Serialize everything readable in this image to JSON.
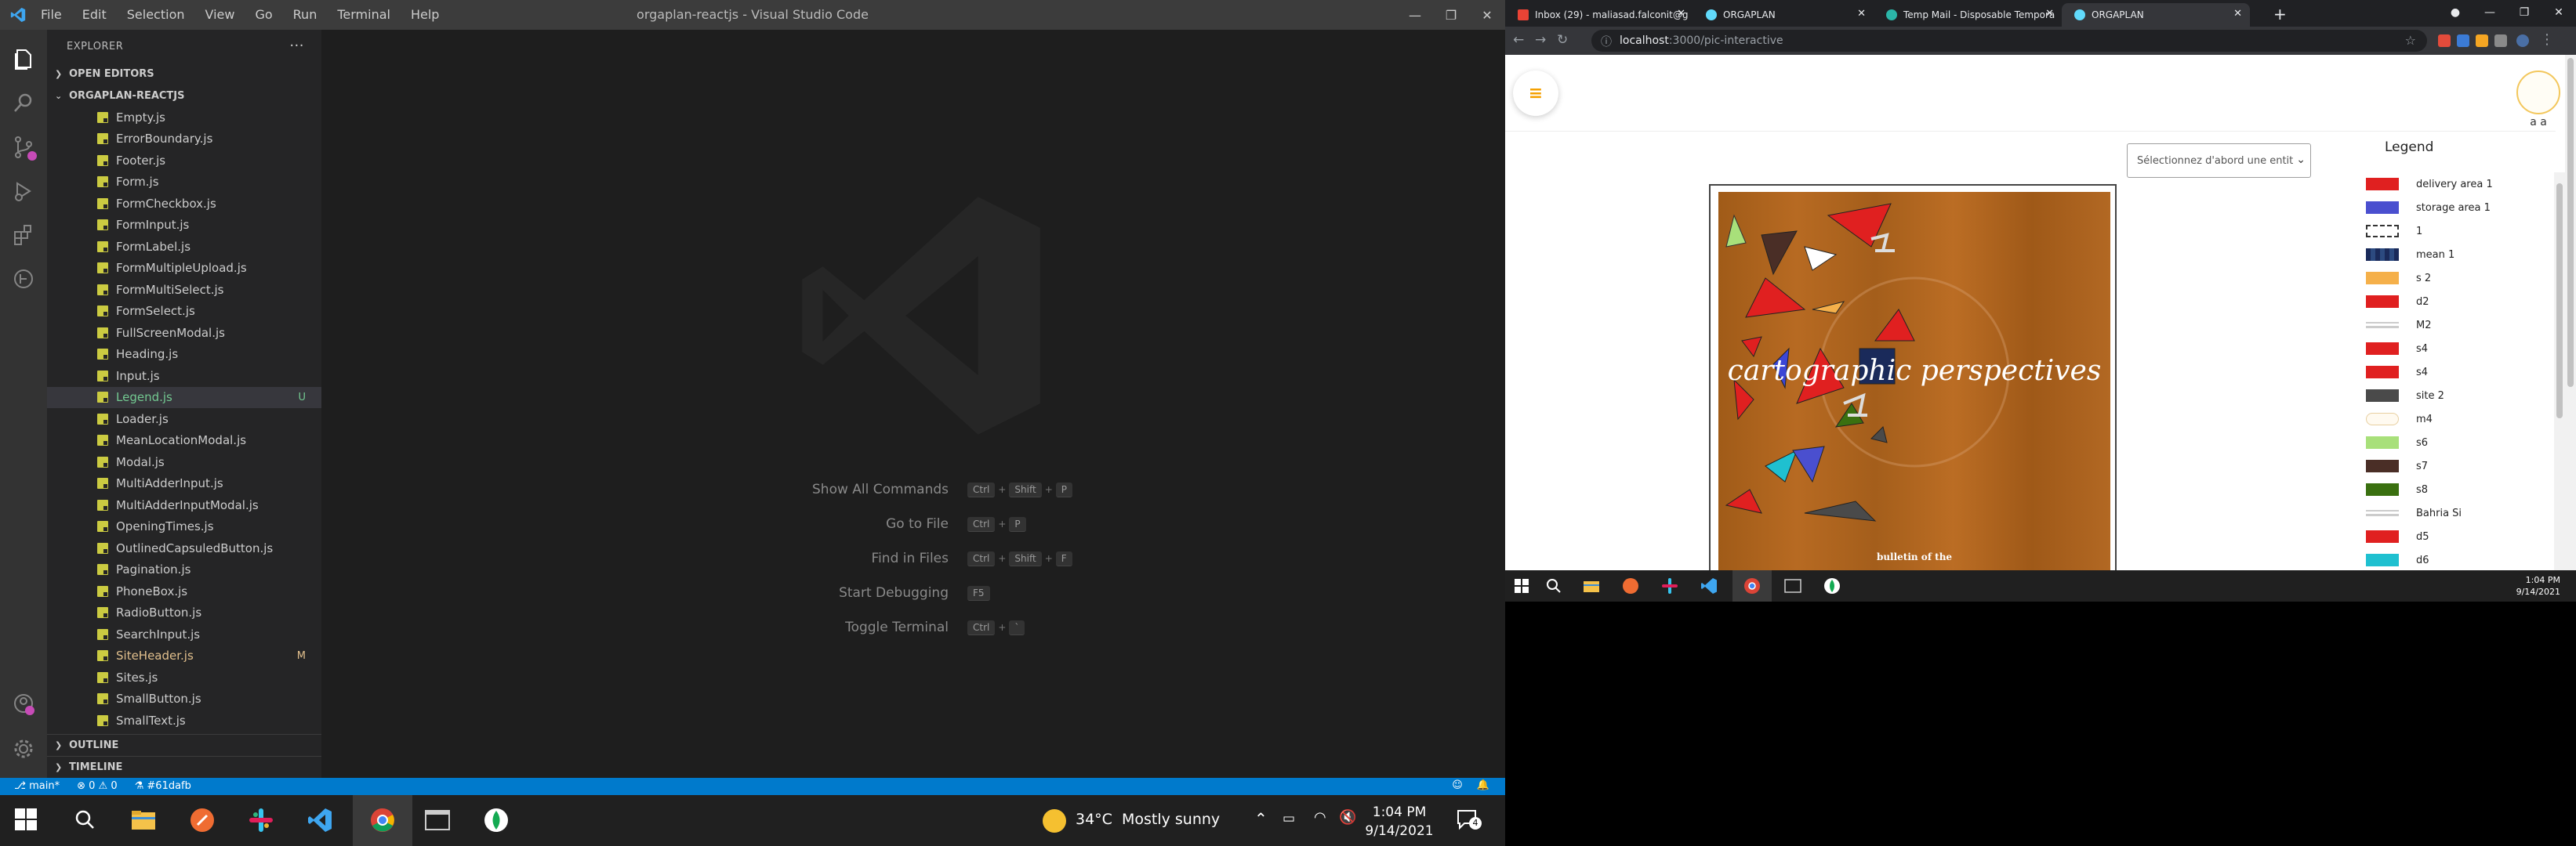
{
  "vscode": {
    "window_title": "orgaplan-reactjs - Visual Studio Code",
    "menu": [
      "File",
      "Edit",
      "Selection",
      "View",
      "Go",
      "Run",
      "Terminal",
      "Help"
    ],
    "explorer_label": "EXPLORER",
    "more_actions": "···",
    "open_editors": "OPEN EDITORS",
    "project": "ORGAPLAN-REACTJS",
    "files": [
      {
        "name": "Empty.js",
        "badge": "",
        "state": ""
      },
      {
        "name": "ErrorBoundary.js",
        "badge": "",
        "state": ""
      },
      {
        "name": "Footer.js",
        "badge": "",
        "state": ""
      },
      {
        "name": "Form.js",
        "badge": "",
        "state": ""
      },
      {
        "name": "FormCheckbox.js",
        "badge": "",
        "state": ""
      },
      {
        "name": "FormInput.js",
        "badge": "",
        "state": ""
      },
      {
        "name": "FormLabel.js",
        "badge": "",
        "state": ""
      },
      {
        "name": "FormMultipleUpload.js",
        "badge": "",
        "state": ""
      },
      {
        "name": "FormMultiSelect.js",
        "badge": "",
        "state": ""
      },
      {
        "name": "FormSelect.js",
        "badge": "",
        "state": ""
      },
      {
        "name": "FullScreenModal.js",
        "badge": "",
        "state": ""
      },
      {
        "name": "Heading.js",
        "badge": "",
        "state": ""
      },
      {
        "name": "Input.js",
        "badge": "",
        "state": ""
      },
      {
        "name": "Legend.js",
        "badge": "U",
        "state": "untracked"
      },
      {
        "name": "Loader.js",
        "badge": "",
        "state": ""
      },
      {
        "name": "MeanLocationModal.js",
        "badge": "",
        "state": ""
      },
      {
        "name": "Modal.js",
        "badge": "",
        "state": ""
      },
      {
        "name": "MultiAdderInput.js",
        "badge": "",
        "state": ""
      },
      {
        "name": "MultiAdderInputModal.js",
        "badge": "",
        "state": ""
      },
      {
        "name": "OpeningTimes.js",
        "badge": "",
        "state": ""
      },
      {
        "name": "OutlinedCapsuledButton.js",
        "badge": "",
        "state": ""
      },
      {
        "name": "Pagination.js",
        "badge": "",
        "state": ""
      },
      {
        "name": "PhoneBox.js",
        "badge": "",
        "state": ""
      },
      {
        "name": "RadioButton.js",
        "badge": "",
        "state": ""
      },
      {
        "name": "SearchInput.js",
        "badge": "",
        "state": ""
      },
      {
        "name": "SiteHeader.js",
        "badge": "M",
        "state": "modified"
      },
      {
        "name": "Sites.js",
        "badge": "",
        "state": ""
      },
      {
        "name": "SmallButton.js",
        "badge": "",
        "state": ""
      },
      {
        "name": "SmallText.js",
        "badge": "",
        "state": ""
      }
    ],
    "outline": "OUTLINE",
    "timeline": "TIMELINE",
    "shortcuts": [
      {
        "label": "Show All Commands",
        "keys": [
          "Ctrl",
          "Shift",
          "P"
        ]
      },
      {
        "label": "Go to File",
        "keys": [
          "Ctrl",
          "P"
        ]
      },
      {
        "label": "Find in Files",
        "keys": [
          "Ctrl",
          "Shift",
          "F"
        ]
      },
      {
        "label": "Start Debugging",
        "keys": [
          "F5"
        ]
      },
      {
        "label": "Toggle Terminal",
        "keys": [
          "Ctrl",
          "`"
        ]
      }
    ],
    "status": {
      "branch": "main*",
      "problems": "⊗ 0 ⚠ 0",
      "commit": "#61dafb"
    },
    "accent": "#007acc"
  },
  "taskbar_left": {
    "weather": "34°C",
    "weather_text": "Mostly sunny",
    "time": "1:04 PM",
    "date": "9/14/2021",
    "notifications": "4"
  },
  "chrome": {
    "tabs": [
      {
        "title": "Inbox (29) - maliasad.falconit@g",
        "active": false
      },
      {
        "title": "ORGAPLAN",
        "active": false
      },
      {
        "title": "Temp Mail - Disposable Tempora",
        "active": false
      },
      {
        "title": "ORGAPLAN",
        "active": true
      }
    ],
    "url_host": "localhost",
    "url_path": ":3000/pic-interactive",
    "page": {
      "avatar_name": "a a",
      "select_placeholder": "Sélectionnez d'abord une entit",
      "legend_title": "Legend",
      "map_title": "cartographic  perspectives",
      "map_footer": "bulletin of the",
      "legend": [
        {
          "label": "delivery area 1",
          "color": "#e02020",
          "style": "solid"
        },
        {
          "label": "storage area 1",
          "color": "#4a4fcf",
          "style": "solid"
        },
        {
          "label": "1",
          "color": "#ffffff",
          "style": "dashed"
        },
        {
          "label": "mean 1",
          "color": "#1a2a5a",
          "style": "pattern"
        },
        {
          "label": "s 2",
          "color": "#f5b04a",
          "style": "solid"
        },
        {
          "label": "d2",
          "color": "#e02020",
          "style": "solid"
        },
        {
          "label": "M2",
          "color": "#cccccc",
          "style": "crane"
        },
        {
          "label": "s4",
          "color": "#e02020",
          "style": "solid"
        },
        {
          "label": "s4",
          "color": "#e02020",
          "style": "solid"
        },
        {
          "label": "site 2",
          "color": "#4a4a4a",
          "style": "solid"
        },
        {
          "label": "m4",
          "color": "#f3e0c0",
          "style": "outline"
        },
        {
          "label": "s6",
          "color": "#a8e07a",
          "style": "solid"
        },
        {
          "label": "s7",
          "color": "#4a2e26",
          "style": "solid"
        },
        {
          "label": "s8",
          "color": "#3a7010",
          "style": "solid"
        },
        {
          "label": "Bahria Si",
          "color": "#cccccc",
          "style": "crane"
        },
        {
          "label": "d5",
          "color": "#e02020",
          "style": "solid"
        },
        {
          "label": "d6",
          "color": "#1fc0d0",
          "style": "solid"
        }
      ]
    }
  },
  "taskbar_right": {
    "time": "1:04 PM",
    "date": "9/14/2021"
  }
}
